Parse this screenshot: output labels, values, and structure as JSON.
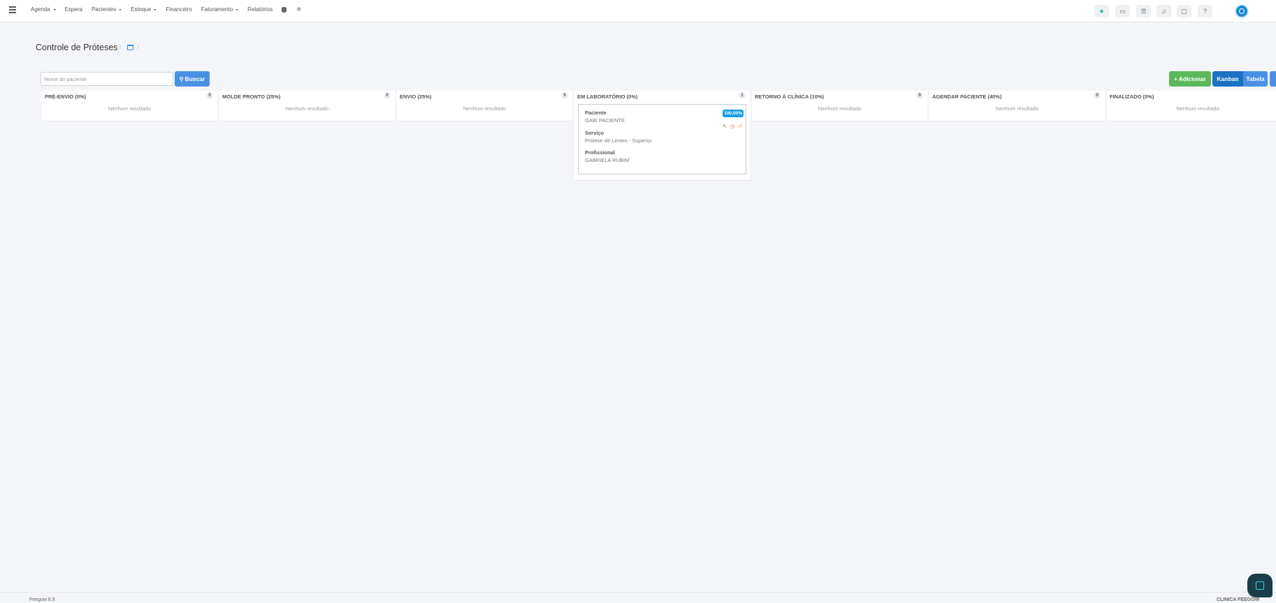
{
  "nav": {
    "items": [
      {
        "label": "Agenda",
        "dropdown": true
      },
      {
        "label": "Espera",
        "dropdown": false
      },
      {
        "label": "Pacientes",
        "dropdown": true
      },
      {
        "label": "Estoque",
        "dropdown": true
      },
      {
        "label": "Financeiro",
        "dropdown": false
      },
      {
        "label": "Faturamento",
        "dropdown": true
      },
      {
        "label": "Relatórios",
        "dropdown": false
      }
    ],
    "icons": [
      "database-icon",
      "gear-icon"
    ]
  },
  "toolbar": {
    "buttons": [
      "star-icon",
      "inbox-icon",
      "list-icon",
      "bell-icon",
      "chat-icon",
      "help-icon"
    ],
    "accent": "#1bb8a4"
  },
  "page": {
    "title": "Controle de Próteses",
    "breadcrumb_sep": "/"
  },
  "search": {
    "placeholder": "Nome do paciente",
    "button_label": "Buscar"
  },
  "actions": {
    "add_label": "Adicionar",
    "kanban_label": "Kanban",
    "tabela_label": "Tabela"
  },
  "columns": [
    {
      "title": "PRÉ-ENVIO (0%)",
      "count": "0",
      "empty_text": "Nenhum resultado"
    },
    {
      "title": "MOLDE PRONTO (25%)",
      "count": "0",
      "empty_text": "Nenhum resultado"
    },
    {
      "title": "ENVIO (25%)",
      "count": "0",
      "empty_text": "Nenhum resultado"
    },
    {
      "title": "EM LABORATÓRIO (0%)",
      "count": "1",
      "empty_text": ""
    },
    {
      "title": "RETORNO À CLÍNICA (10%)",
      "count": "0",
      "empty_text": "Nenhum resultado"
    },
    {
      "title": "AGENDAR PACIENTE (40%)",
      "count": "0",
      "empty_text": "Nenhum resultado"
    },
    {
      "title": "FINALIZADO (0%)",
      "count": "0",
      "empty_text": "Nenhum resultado"
    }
  ],
  "card": {
    "badge": "100,00%",
    "paciente_label": "Paciente",
    "paciente_value": "GABI PACIENTE",
    "servico_label": "Serviço",
    "servico_value": "Prótese de Lentes - Superior",
    "profissional_label": "Profissional",
    "profissional_value": "GABRIELA RUBIM"
  },
  "footer": {
    "version": "Feegow 8.9",
    "clinic": "CLINICA FEEGOW"
  }
}
